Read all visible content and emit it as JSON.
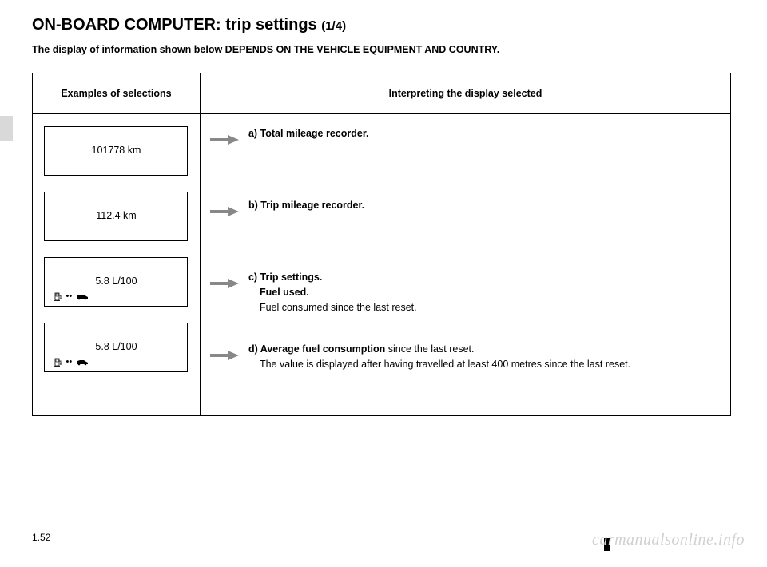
{
  "title_main": "ON-BOARD COMPUTER: trip settings ",
  "title_page": "(1/4)",
  "subtitle": "The display of information shown below DEPENDS ON THE VEHICLE EQUIPMENT AND COUNTRY.",
  "headers": {
    "left": "Examples of selections",
    "right": "Interpreting the display selected"
  },
  "rows": [
    {
      "display_value": "101778 km",
      "has_icons": false,
      "desc_label": "a) Total mileage recorder.",
      "desc_extra_bold": "",
      "desc_extra": ""
    },
    {
      "display_value": "112.4 km",
      "has_icons": false,
      "desc_label": "b) Trip mileage recorder.",
      "desc_extra_bold": "",
      "desc_extra": ""
    },
    {
      "display_value": "5.8 L/100",
      "has_icons": true,
      "desc_label": "c) Trip settings.",
      "desc_extra_bold": "Fuel used.",
      "desc_extra": "Fuel consumed since the last reset."
    },
    {
      "display_value": "5.8 L/100",
      "has_icons": true,
      "desc_label": "d) Average fuel consumption",
      "desc_inline_after": " since the last reset.",
      "desc_extra_bold": "",
      "desc_extra": "The value is displayed after having travelled at least 400 metres since the last reset."
    }
  ],
  "page_number": "1.52",
  "watermark": "carmanualsonline.info"
}
